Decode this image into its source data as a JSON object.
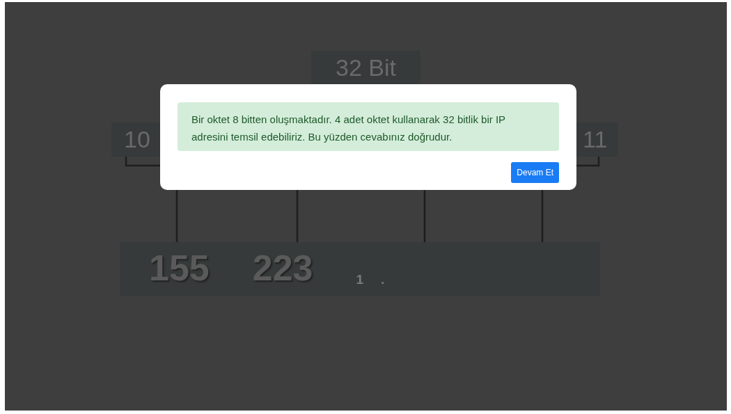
{
  "diagram": {
    "header": "32 Bit",
    "left_octet": "10",
    "right_octet": "11",
    "address_parts": [
      {
        "text": "155",
        "kind": "large"
      },
      {
        "text": "223",
        "kind": "large"
      },
      {
        "text": "1",
        "kind": "small"
      },
      {
        "text": ".",
        "kind": "small"
      }
    ]
  },
  "modal": {
    "message": "Bir oktet 8 bitten oluşmaktadır. 4 adet oktet kullanarak 32 bitlik bir IP adresini temsil edebiliriz. Bu yüzden cevabınız doğrudur.",
    "button": "Devam Et"
  }
}
